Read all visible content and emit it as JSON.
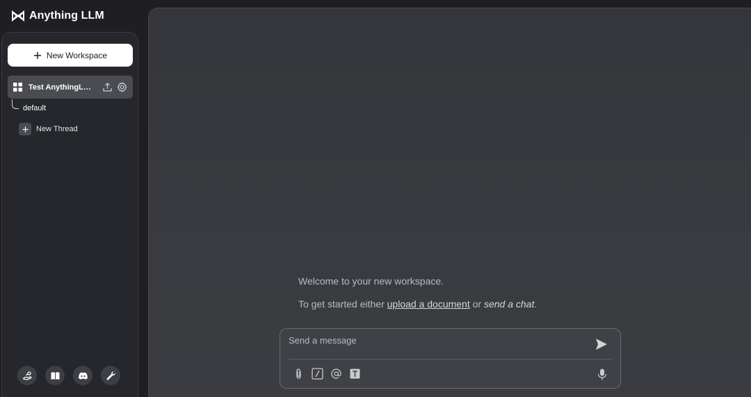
{
  "app": {
    "name": "Anything LLM"
  },
  "sidebar": {
    "new_workspace_label": "New Workspace",
    "workspace": {
      "name": "Test AnythingLLM"
    },
    "threads": [
      {
        "label": "default"
      }
    ],
    "new_thread_label": "New Thread",
    "footer_icons": [
      "community-hub-icon",
      "docs-book-icon",
      "discord-icon",
      "settings-wrench-icon"
    ]
  },
  "main": {
    "welcome_text": "Welcome to your new workspace.",
    "get_started_prefix": "To get started either",
    "upload_link": "upload a document",
    "or_text": "or",
    "send_chat_text": "send a chat",
    "period": "."
  },
  "composer": {
    "placeholder": "Send a message",
    "tools": [
      "attach-icon",
      "slash-command-icon",
      "at-mention-icon",
      "text-size-icon"
    ]
  },
  "colors": {
    "background": "#1f1f23",
    "sidebar": "#25272c",
    "main_panel": "#393b40",
    "workspace_active": "#4a4c52",
    "primary_button": "#ffffff"
  }
}
